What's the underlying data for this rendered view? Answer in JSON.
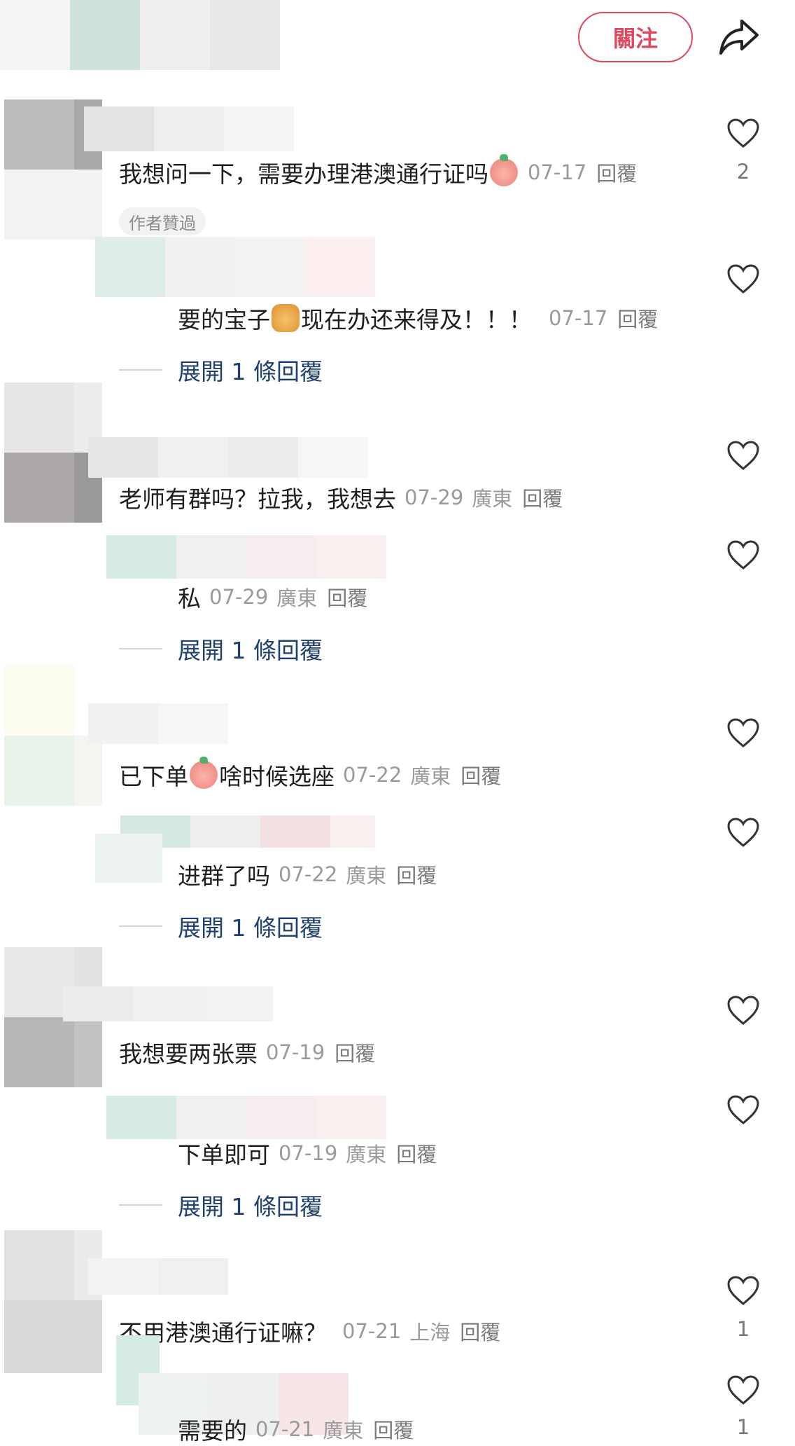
{
  "header": {
    "follow_label": "關注"
  },
  "comments": [
    {
      "text": "我想问一下，需要办理港澳通行证吗",
      "emoji": "peach-shy",
      "date": "07-17",
      "location": "",
      "reply": "回覆",
      "badge": "作者贊過",
      "likes": "2"
    },
    {
      "text": "要的宝子",
      "emoji": "cat-face",
      "text2": "现在办还来得及！！！",
      "date": "07-17",
      "location": "",
      "reply": "回覆",
      "likes": ""
    },
    {
      "text": "老师有群吗？拉我，我想去",
      "date": "07-29",
      "location": "廣東",
      "reply": "回覆",
      "likes": ""
    },
    {
      "text": "私",
      "date": "07-29",
      "location": "廣東",
      "reply": "回覆",
      "likes": ""
    },
    {
      "text": "已下单",
      "emoji": "peach-smile",
      "text2": "啥时候选座",
      "date": "07-22",
      "location": "廣東",
      "reply": "回覆",
      "likes": ""
    },
    {
      "text": "进群了吗",
      "date": "07-22",
      "location": "廣東",
      "reply": "回覆",
      "likes": ""
    },
    {
      "text": "我想要两张票",
      "date": "07-19",
      "location": "",
      "reply": "回覆",
      "likes": ""
    },
    {
      "text": "下单即可",
      "date": "07-19",
      "location": "廣東",
      "reply": "回覆",
      "likes": ""
    },
    {
      "text": "不用港澳通行证嘛？",
      "date": "07-21",
      "location": "上海",
      "reply": "回覆",
      "likes": "1"
    },
    {
      "text": "需要的",
      "date": "07-21",
      "location": "廣東",
      "reply": "回覆",
      "likes": "1"
    }
  ],
  "expand_replies": {
    "label": "展開 1 條回覆"
  },
  "icons": {
    "share": "share-arrow-icon",
    "like": "heart-outline-icon",
    "emoji_peach": "peach-emoji-icon",
    "emoji_cat": "cat-emoji-icon"
  },
  "colors": {
    "accent": "#e0485e",
    "link": "#20406e",
    "meta": "#9a9a9a"
  }
}
